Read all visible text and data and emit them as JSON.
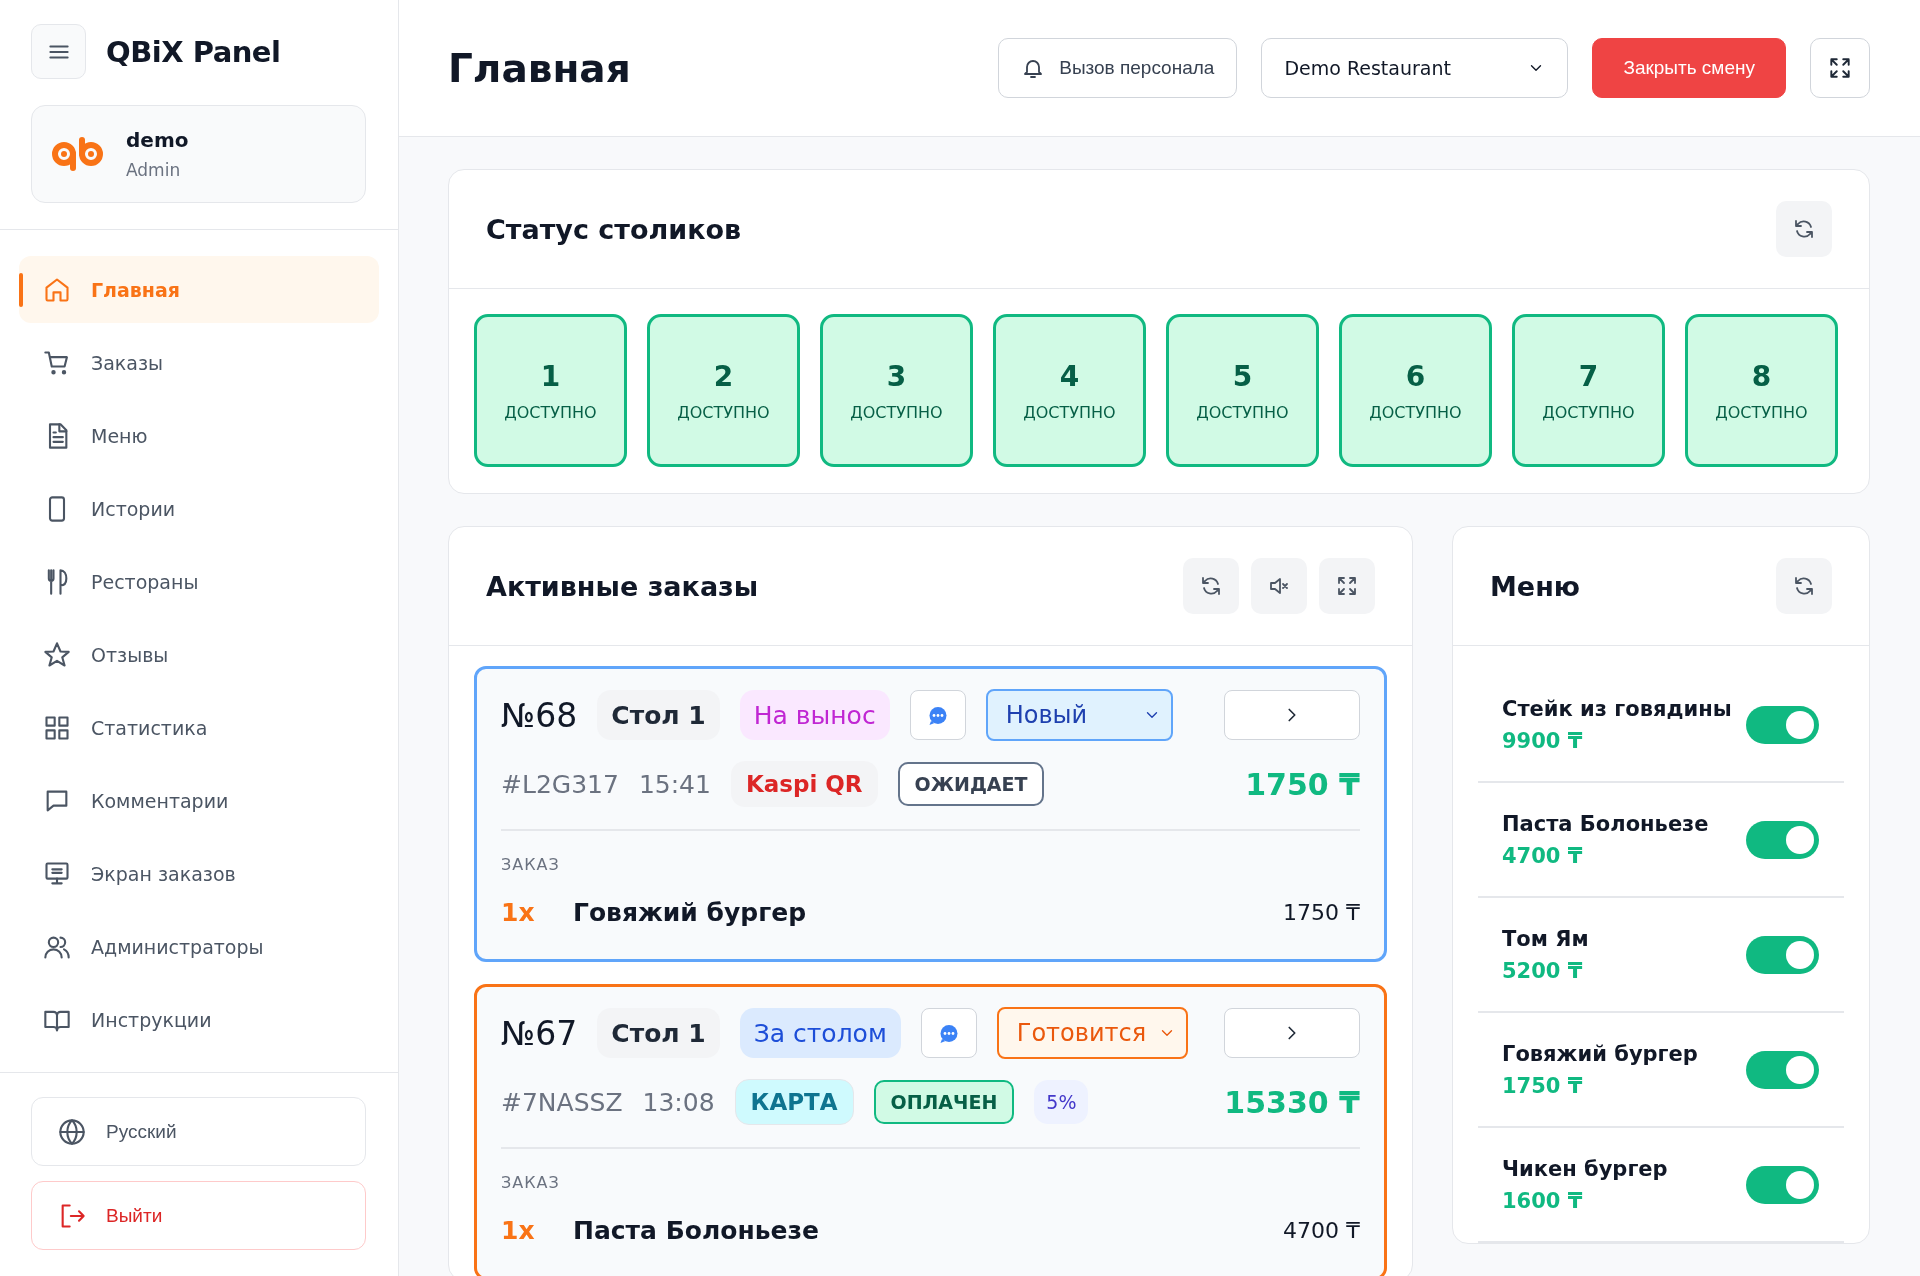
{
  "sidebar": {
    "title": "QBiX Panel",
    "user": {
      "name": "demo",
      "role": "Admin"
    },
    "nav": [
      {
        "label": "Главная",
        "selected": true
      },
      {
        "label": "Заказы",
        "selected": false
      },
      {
        "label": "Меню",
        "selected": false
      },
      {
        "label": "Истории",
        "selected": false
      },
      {
        "label": "Рестораны",
        "selected": false
      },
      {
        "label": "Отзывы",
        "selected": false
      },
      {
        "label": "Статистика",
        "selected": false
      },
      {
        "label": "Комментарии",
        "selected": false
      },
      {
        "label": "Экран заказов",
        "selected": false
      },
      {
        "label": "Администраторы",
        "selected": false
      },
      {
        "label": "Инструкции",
        "selected": false
      }
    ],
    "language": "Русский",
    "logout": "Выйти"
  },
  "header": {
    "title": "Главная",
    "call_staff": "Вызов персонала",
    "restaurant": "Demo Restaurant",
    "close_shift": "Закрыть смену"
  },
  "tables_card": {
    "title": "Статус столиков",
    "tables": [
      {
        "number": "1",
        "status": "ДОСТУПНО",
        "kind": "available"
      },
      {
        "number": "2",
        "status": "ДОСТУПНО",
        "kind": "available"
      },
      {
        "number": "3",
        "status": "ДОСТУПНО",
        "kind": "available"
      },
      {
        "number": "4",
        "status": "ДОСТУПНО",
        "kind": "available"
      },
      {
        "number": "5",
        "status": "ДОСТУПНО",
        "kind": "available"
      },
      {
        "number": "6",
        "status": "ДОСТУПНО",
        "kind": "available"
      },
      {
        "number": "7",
        "status": "ДОСТУПНО",
        "kind": "available"
      },
      {
        "number": "8",
        "status": "ДОСТУПНО",
        "kind": "available"
      }
    ]
  },
  "orders_card": {
    "title": "Активные заказы",
    "orders": [
      {
        "number": "№68",
        "table": "Стол 1",
        "service": {
          "text": "На вынос",
          "kind": "takeaway"
        },
        "status": {
          "text": "Новый",
          "kind": "new"
        },
        "code": "#L2G317",
        "time": "15:41",
        "payment": {
          "text": "Kaspi QR",
          "kind": "kaspi"
        },
        "payment_state": {
          "text": "ОЖИДАЕТ",
          "kind": "pending"
        },
        "total": "1750 ₸",
        "section": "ЗАКАЗ",
        "items": [
          {
            "qty": "1x",
            "name": "Говяжий бургер",
            "price": "1750 ₸"
          }
        ]
      },
      {
        "number": "№67",
        "table": "Стол 1",
        "service": {
          "text": "За столом",
          "kind": "dine_in"
        },
        "status": {
          "text": "Готовится",
          "kind": "cooking"
        },
        "code": "#7NASSZ",
        "time": "13:08",
        "payment": {
          "text": "КАРТА",
          "kind": "card"
        },
        "payment_state": {
          "text": "ОПЛАЧЕН",
          "kind": "paid"
        },
        "discount": "5%",
        "total": "15330 ₸",
        "section": "ЗАКАЗ",
        "items": [
          {
            "qty": "1x",
            "name": "Паста Болоньезе",
            "price": "4700 ₸"
          }
        ]
      }
    ]
  },
  "menu_card": {
    "title": "Меню",
    "items": [
      {
        "name": "Стейк из говядины",
        "price": "9900 ₸",
        "on": true
      },
      {
        "name": "Паста Болоньезе",
        "price": "4700 ₸",
        "on": true
      },
      {
        "name": "Том Ям",
        "price": "5200 ₸",
        "on": true
      },
      {
        "name": "Говяжий бургер",
        "price": "1750 ₸",
        "on": true
      },
      {
        "name": "Чикен бургер",
        "price": "1600 ₸",
        "on": true
      }
    ]
  }
}
